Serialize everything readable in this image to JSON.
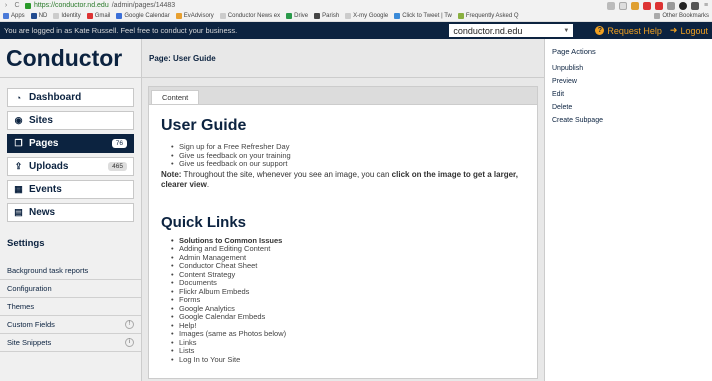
{
  "browser": {
    "url_host": "https://conductor.nd.edu",
    "url_path": "/admin/pages/14483",
    "bookmarks": [
      "Apps",
      "ND",
      "Identity",
      "Gmail",
      "Google Calendar",
      "EvAdvisory",
      "Conductor News ex",
      "Drive",
      "Parish",
      "X-my Google",
      "Click to Tweet | Tw",
      "Frequently Asked Q"
    ],
    "other_bookmarks": "Other Bookmarks"
  },
  "topbar": {
    "message": "You are logged in as Kate Russell. Feel free to conduct your business.",
    "site_select": "conductor.nd.edu",
    "request_help": "Request Help",
    "logout": "Logout"
  },
  "sidebar": {
    "logo": "Conductor",
    "nav": [
      {
        "label": "Dashboard",
        "icon": "dashboard-icon",
        "glyph": "◔",
        "count": ""
      },
      {
        "label": "Sites",
        "icon": "globe-icon",
        "glyph": "◉",
        "count": ""
      },
      {
        "label": "Pages",
        "icon": "pages-icon",
        "glyph": "❐",
        "count": "76"
      },
      {
        "label": "Uploads",
        "icon": "upload-icon",
        "glyph": "⇪",
        "count": "465"
      },
      {
        "label": "Events",
        "icon": "calendar-icon",
        "glyph": "▦",
        "count": ""
      },
      {
        "label": "News",
        "icon": "news-icon",
        "glyph": "▤",
        "count": ""
      }
    ],
    "settings_title": "Settings",
    "settings": [
      "Background task reports",
      "Configuration",
      "Themes",
      "Custom Fields",
      "Site Snippets"
    ]
  },
  "main": {
    "page_title": "Page: User Guide",
    "tab": "Content",
    "heading": "User Guide",
    "bullets": [
      "Sign up for a Free Refresher Day",
      "Give us feedback on your training",
      "Give us feedback on our support"
    ],
    "note_label": "Note:",
    "note_text": " Throughout the site, whenever you see an image, you can ",
    "note_bold": "click on the image to get a larger, clearer view",
    "note_end": ".",
    "quick_links_heading": "Quick Links",
    "quick_links": [
      "Solutions to Common Issues",
      "Adding and Editing Content",
      "Admin Management",
      "Conductor Cheat Sheet",
      "Content Strategy",
      "Documents",
      "Flickr Album Embeds",
      "Forms",
      "Google Analytics",
      "Google Calendar Embeds",
      "Help!",
      "Images (same as Photos below)",
      "Links",
      "Lists",
      "Log In to Your Site"
    ]
  },
  "actions": {
    "title": "Page Actions",
    "links": [
      "Unpublish",
      "Preview",
      "Edit",
      "Delete",
      "Create Subpage"
    ]
  }
}
